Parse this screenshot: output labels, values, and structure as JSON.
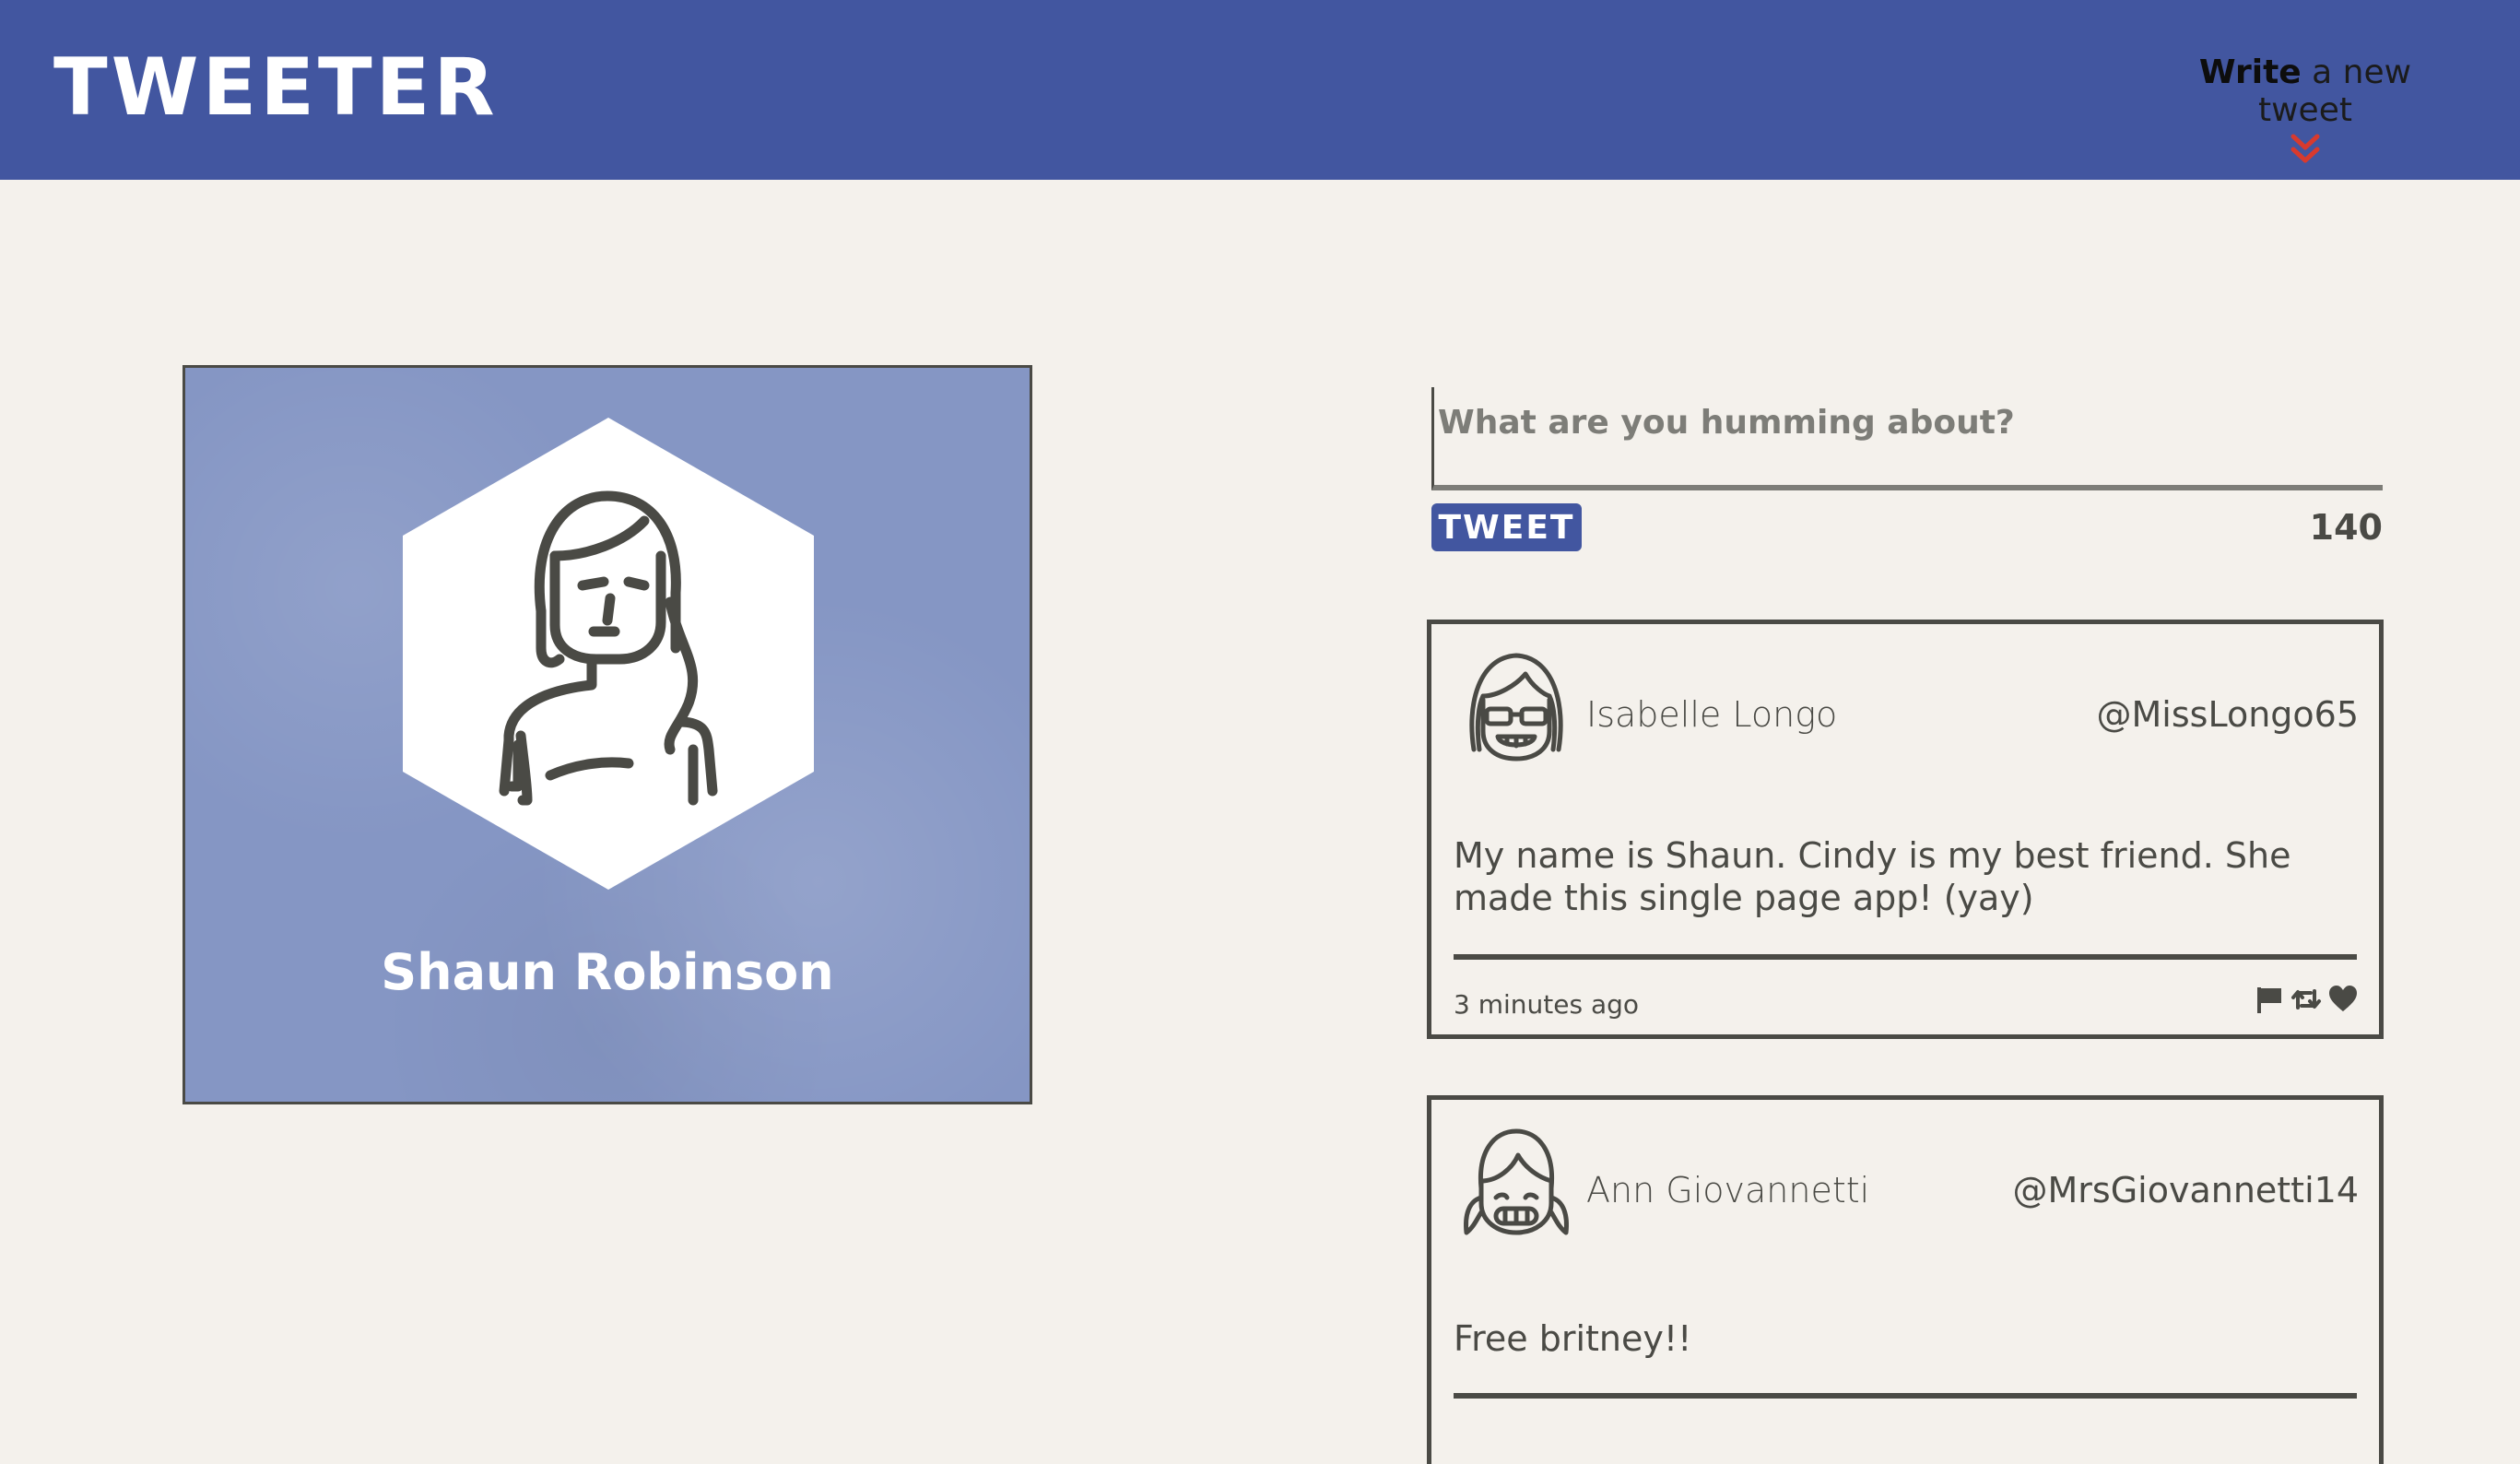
{
  "header": {
    "brand": "TWEETER",
    "compose_toggle": {
      "bold": "Write",
      "rest": " a new tweet",
      "icon": "double-chevron-down-icon"
    }
  },
  "profile": {
    "name": "Shaun Robinson",
    "avatar_icon": "user-avatar-icon"
  },
  "compose": {
    "placeholder": "What are you humming about?",
    "value": "",
    "button_label": "TWEET",
    "counter": "140"
  },
  "tweets": [
    {
      "name": "Isabelle Longo",
      "handle": "@MissLongo65",
      "content": "My name is Shaun. Cindy is my best friend. She made this single page app! (yay)",
      "time": "3 minutes ago",
      "avatar_icon": "avatar-sunglasses-icon",
      "actions": [
        "flag-icon",
        "retweet-icon",
        "heart-icon"
      ]
    },
    {
      "name": "Ann Giovannetti",
      "handle": "@MrsGiovannetti14",
      "content": "Free britney!!",
      "avatar_icon": "avatar-pigtails-icon"
    }
  ],
  "colors": {
    "nav": "#4256a0",
    "background": "#f4f1ec",
    "profile_card": "#8596c4",
    "ink": "#4a4a45",
    "chevron": "#d83a2e"
  }
}
